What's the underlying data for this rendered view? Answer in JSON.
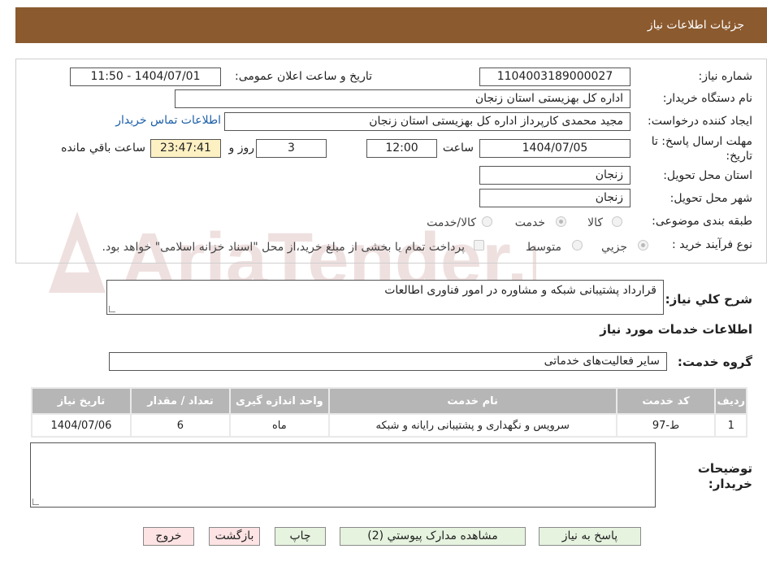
{
  "header": {
    "title": "جزئیات اطلاعات نیاز"
  },
  "form": {
    "need_number": {
      "label": "شماره نیاز:",
      "value": "1104003189000027"
    },
    "announce": {
      "label": "تاریخ و ساعت اعلان عمومی:",
      "value": "1404/07/01 - 11:50"
    },
    "buyer_org": {
      "label": "نام دستگاه خریدار:",
      "value": "اداره كل بهزیستی استان زنجان"
    },
    "requester": {
      "label": "ایجاد کننده درخواست:",
      "value": "مجید محمدی کارپرداز اداره كل بهزیستی استان زنجان"
    },
    "contact_link": "اطلاعات تماس خریدار",
    "deadline": {
      "label_line1": "مهلت ارسال پاسخ: تا",
      "label_line2": "تاریخ:",
      "date": "1404/07/05",
      "time_label": "ساعت",
      "time": "12:00",
      "days": "3",
      "days_label": "روز و",
      "remaining": "23:47:41",
      "remaining_label": "ساعت باقي مانده"
    },
    "province": {
      "label": "استان محل تحویل:",
      "value": "زنجان"
    },
    "city": {
      "label": "شهر محل تحویل:",
      "value": "زنجان"
    },
    "category": {
      "label": "طبقه بندی موضوعی:",
      "options": [
        "کالا",
        "خدمت",
        "کالا/خدمت"
      ],
      "selected": "خدمت"
    },
    "process": {
      "label": "نوع فرآیند خرید :",
      "options": [
        "جزیي",
        "متوسط"
      ],
      "selected": "جزیي",
      "note": "پرداخت تمام یا بخشی از مبلغ خرید،از محل \"اسناد خزانه اسلامی\" خواهد بود."
    }
  },
  "description": {
    "label": "شرح کلي نیاز:",
    "value": "قرارداد پشتیبانی شبکه و مشاوره در امور فناوری اطالعات"
  },
  "services_heading": "اطلاعات خدمات مورد نیاز",
  "service_group": {
    "label": "گروه خدمت:",
    "value": "سایر فعالیت‌های خدماتی"
  },
  "table": {
    "headers": [
      "ردیف",
      "کد خدمت",
      "نام خدمت",
      "واحد اندازه گیری",
      "تعداد / مقدار",
      "تاریخ نیاز"
    ],
    "rows": [
      [
        "1",
        "ط-97",
        "سرویس و نگهداری و پشتیبانی رایانه و شبکه",
        "ماه",
        "6",
        "1404/07/06"
      ]
    ]
  },
  "buyer_notes": {
    "label_line1": "توضیحات",
    "label_line2": "خریدار:",
    "value": ""
  },
  "buttons": {
    "reply": "پاسخ به نیاز",
    "docs": "مشاهده مدارک پیوستي (2)",
    "print": "چاپ",
    "back": "بازگشت",
    "exit": "خروج"
  },
  "watermark": "AriaTender.neT",
  "colors": {
    "header": "#8b5a2f",
    "link": "#1d5fa8",
    "timer_bg": "#fdf1c3",
    "btn_green": "#e6f3df",
    "btn_red": "#fde3e3"
  }
}
